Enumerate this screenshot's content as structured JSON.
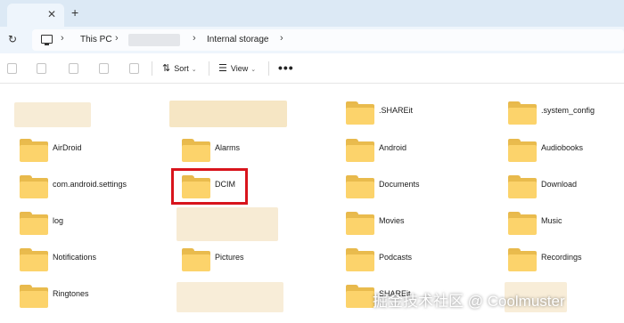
{
  "tabbar": {
    "close_glyph": "✕",
    "new_tab_glyph": "+"
  },
  "address": {
    "refresh_glyph": "↻",
    "icon": "pc-icon",
    "crumbs": [
      "This PC",
      "Internal storage"
    ],
    "separator": "›"
  },
  "toolbar": {
    "sort_label": "Sort",
    "view_label": "View",
    "more_label": "•••",
    "caret": "⌄",
    "sort_glyph": "⇅",
    "view_glyph": "☰"
  },
  "folders": [
    {
      "name": ".SHAREit"
    },
    {
      "name": ".system_config"
    },
    {
      "name": "AirDroid"
    },
    {
      "name": "Alarms"
    },
    {
      "name": "Android"
    },
    {
      "name": "Audiobooks"
    },
    {
      "name": "com.android.settings"
    },
    {
      "name": "DCIM"
    },
    {
      "name": "Documents"
    },
    {
      "name": "Download"
    },
    {
      "name": "log"
    },
    {
      "name": "Movies"
    },
    {
      "name": "Music"
    },
    {
      "name": "Notifications"
    },
    {
      "name": "Pictures"
    },
    {
      "name": "Podcasts"
    },
    {
      "name": "Recordings"
    },
    {
      "name": "Ringtones"
    },
    {
      "name": "SHAREit"
    }
  ],
  "highlighted_folder": "DCIM",
  "watermark": "掘金技术社区 @ Coolmuster"
}
